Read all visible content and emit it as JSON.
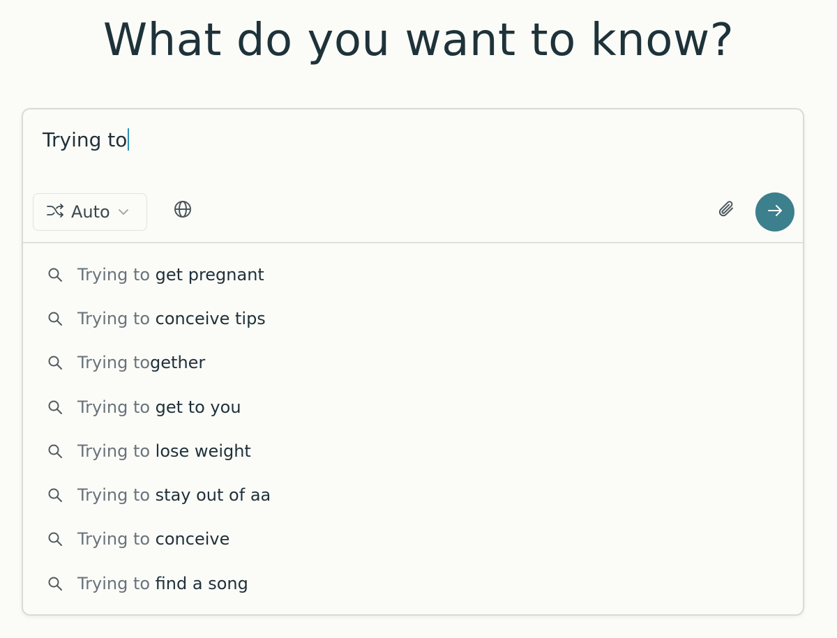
{
  "header": {
    "title": "What do you want to know?"
  },
  "search": {
    "query": "Trying to",
    "mode_label": "Auto",
    "icons": {
      "mode": "shuffle-icon",
      "mode_chevron": "chevron-down-icon",
      "web": "globe-icon",
      "attach": "paperclip-icon",
      "submit": "arrow-right-icon",
      "suggestion": "search-icon"
    },
    "colors": {
      "submit_bg": "#3c7f8d",
      "caret": "#2f8fb4",
      "text": "#1f3038",
      "prefix_text": "#68737a",
      "background": "#fbfbf8"
    }
  },
  "suggestions": [
    {
      "prefix": "Trying to ",
      "completion": "get pregnant"
    },
    {
      "prefix": "Trying to ",
      "completion": "conceive tips"
    },
    {
      "prefix": "Trying to",
      "completion": "gether"
    },
    {
      "prefix": "Trying to ",
      "completion": "get to you"
    },
    {
      "prefix": "Trying to ",
      "completion": "lose weight"
    },
    {
      "prefix": "Trying to ",
      "completion": "stay out of aa"
    },
    {
      "prefix": "Trying to ",
      "completion": "conceive"
    },
    {
      "prefix": "Trying to ",
      "completion": "find a song"
    }
  ]
}
